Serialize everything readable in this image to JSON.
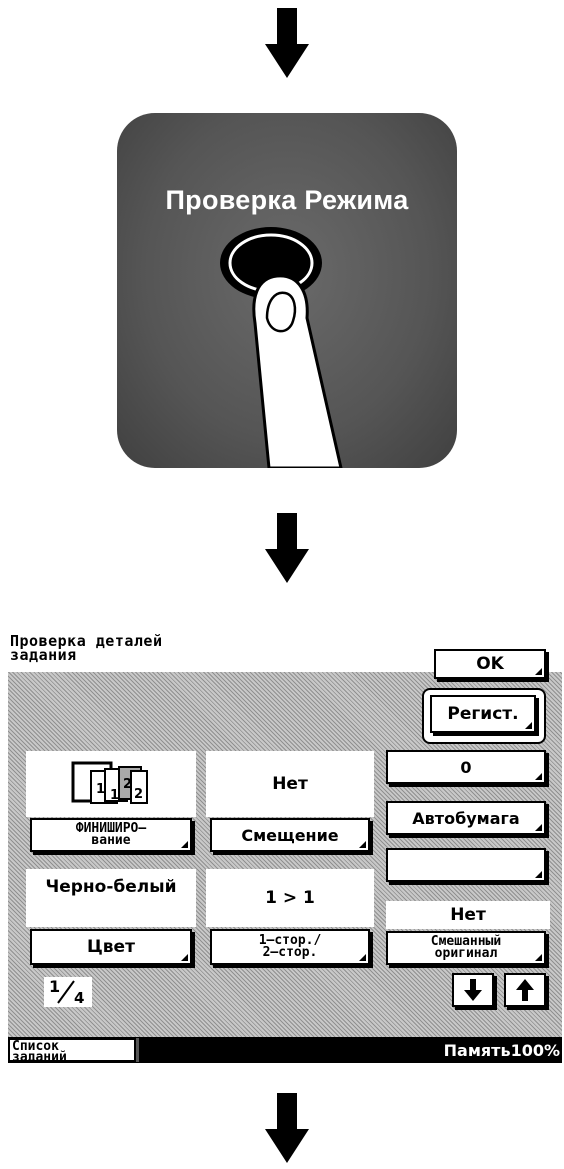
{
  "panel": {
    "title": "Проверка Режима"
  },
  "screen": {
    "header": {
      "title_line1": "Проверка деталей",
      "title_line2": "задания"
    },
    "ok_label": "OK",
    "register_label": "Регист.",
    "column1": {
      "finishing_label_line1": "ФИНИШИРО–",
      "finishing_label_line2": "вание",
      "finishing_icon_numbers": [
        "1",
        "1",
        "2",
        "2"
      ],
      "color_value": "Черно-белый",
      "color_label": "Цвет"
    },
    "column2": {
      "offset_value": "Нет",
      "offset_label": "Смещение",
      "duplex_value": "1 > 1",
      "duplex_label_line1": "1–стор./",
      "duplex_label_line2": "2–стор."
    },
    "column3": {
      "zoom_value": "0",
      "paper_label": "Автобумага",
      "mixed_value": "Нет",
      "mixed_label_line1": "Смешанный",
      "mixed_label_line2": "оригинал"
    },
    "page": {
      "current": "1",
      "total": "4"
    },
    "status": {
      "job_list_line1": "Список",
      "job_list_line2": "заданий",
      "memory": "Память100%"
    }
  }
}
